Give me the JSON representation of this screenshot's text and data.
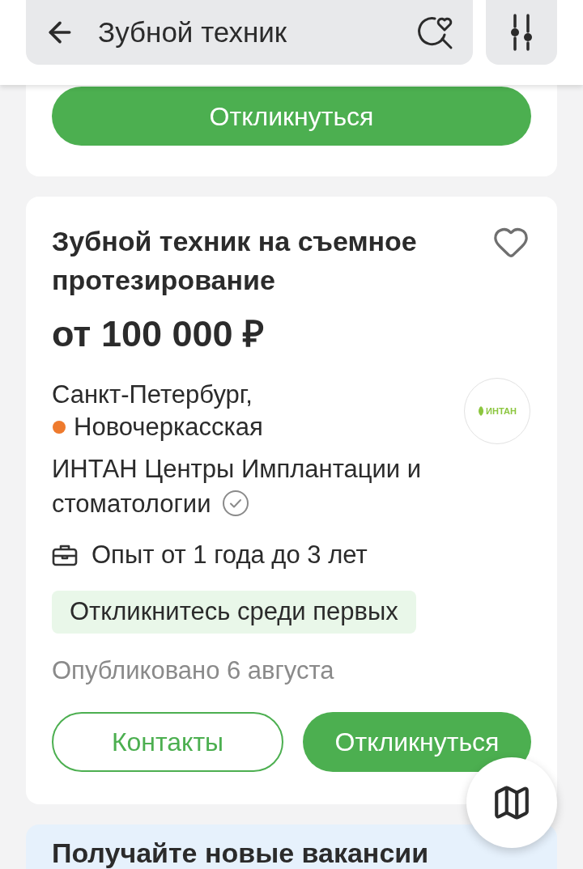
{
  "search": {
    "value": "Зубной техник"
  },
  "top_card": {
    "button": "Откликнуться"
  },
  "vacancy": {
    "title": "Зубной техник на съемное протезирование",
    "favorite": false,
    "salary": "от 100 000 ₽",
    "city": "Санкт-Петербург,",
    "metro": {
      "station": "Новочеркасская",
      "color": "#ee7a2d"
    },
    "company": {
      "name": "ИНТАН Центры Имплантации и стоматологии",
      "verified": true,
      "logo_text": "ИНТАН"
    },
    "experience": "Опыт от 1 года до 3 лет",
    "badge": "Откликнитесь среди первых",
    "published": "Опубликовано 6 августа",
    "buttons": [
      {
        "label": "Контакты",
        "kind": "outline"
      },
      {
        "label": "Откликнуться",
        "kind": "primary"
      }
    ]
  },
  "subscribe_banner": {
    "title": "Получайте новые вакансии"
  }
}
